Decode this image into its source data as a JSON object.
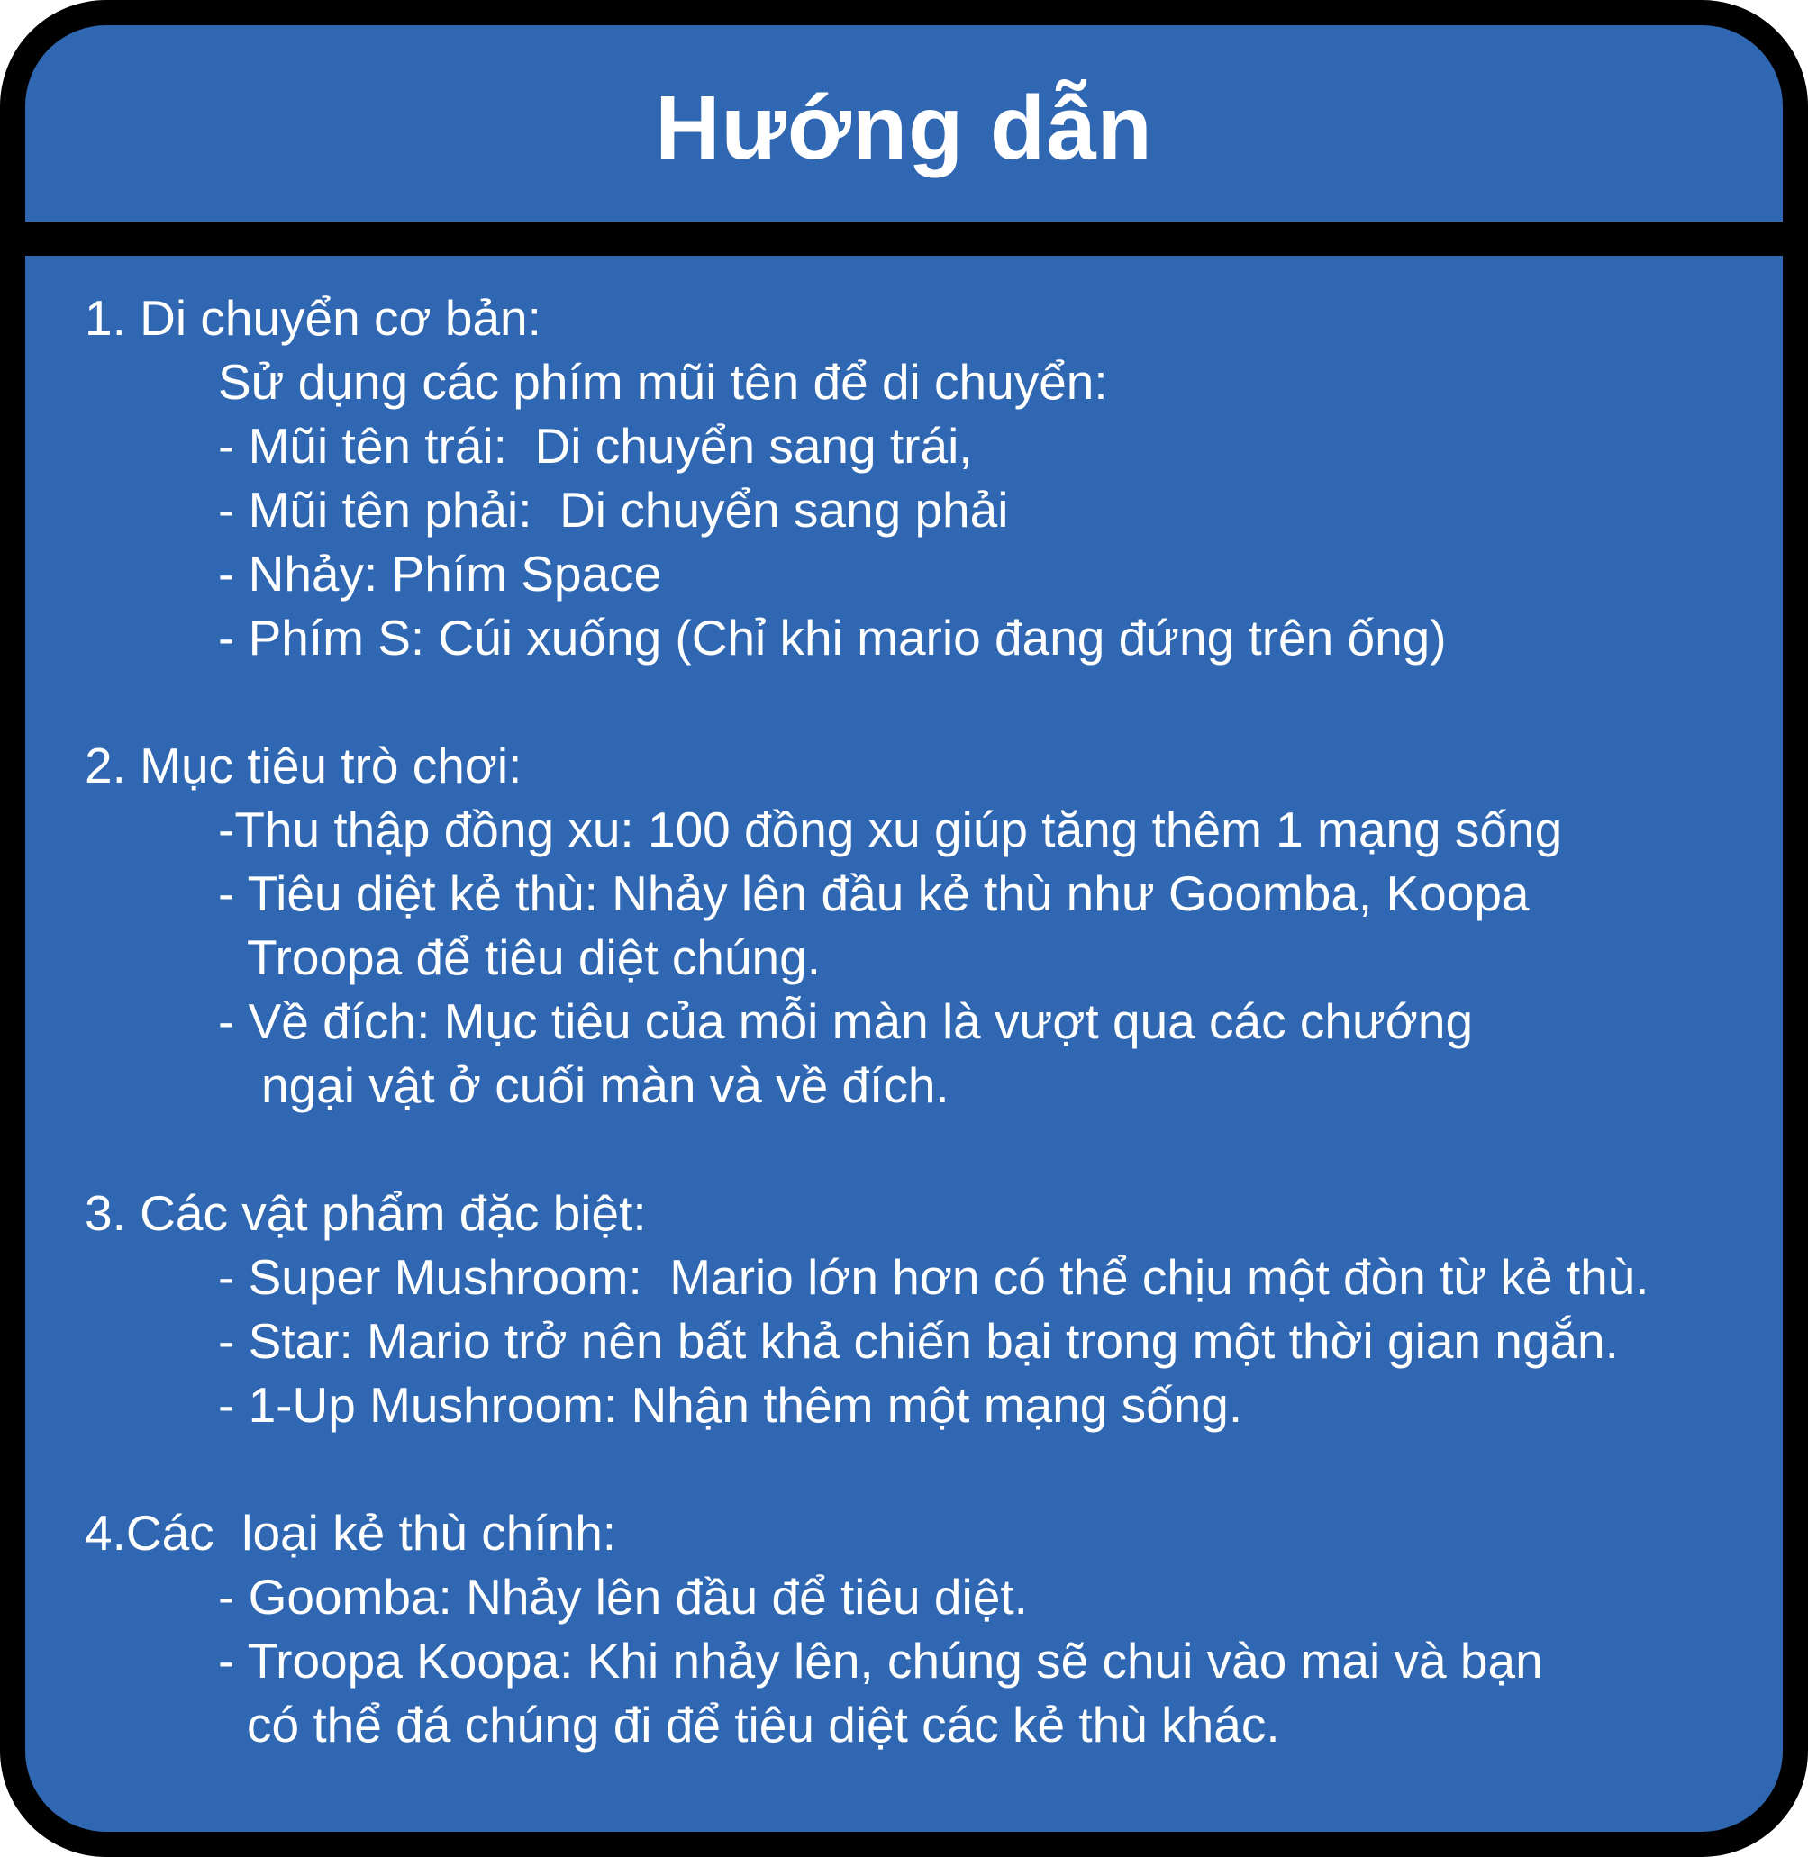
{
  "title": "Hướng dẫn",
  "sections": [
    {
      "heading": "1. Di chuyển cơ bản:",
      "lines": [
        "Sử dụng các phím mũi tên để di chuyển:",
        "- Mũi tên trái:  Di chuyển sang trái,",
        "- Mũi tên phải:  Di chuyển sang phải",
        "- Nhảy: Phím Space",
        "- Phím S: Cúi xuống (Chỉ khi mario đang đứng trên ống)"
      ]
    },
    {
      "heading": "2. Mục tiêu trò chơi:",
      "lines": [
        "-Thu thập đồng xu: 100 đồng xu giúp tăng thêm 1 mạng sống",
        "- Tiêu diệt kẻ thù: Nhảy lên đầu kẻ thù như Goomba, Koopa",
        "Troopa để tiêu diệt chúng.",
        "- Về đích: Mục tiêu của mỗi màn là vượt qua các chướng",
        "ngại vật ở cuối màn và về đích."
      ]
    },
    {
      "heading": "3. Các vật phẩm đặc biệt:",
      "lines": [
        "- Super Mushroom:  Mario lớn hơn có thể chịu một đòn từ kẻ thù.",
        "- Star: Mario trở nên bất khả chiến bại trong một thời gian ngắn.",
        "- 1-Up Mushroom: Nhận thêm một mạng sống."
      ]
    },
    {
      "heading": "4.Các  loại kẻ thù chính:",
      "lines": [
        "- Goomba: Nhảy lên đầu để tiêu diệt.",
        "- Troopa Koopa: Khi nhảy lên, chúng sẽ chui vào mai và bạn",
        "có thể đá chúng đi để tiêu diệt các kẻ thù khác."
      ]
    }
  ]
}
